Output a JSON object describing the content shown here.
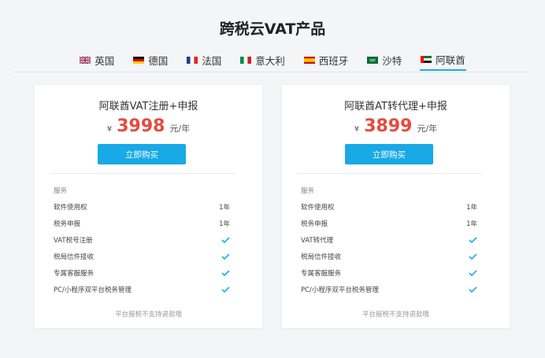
{
  "page": {
    "title": "跨税云VAT产品"
  },
  "tabs": [
    {
      "label": "英国",
      "flag": "uk-flag-icon",
      "active": false
    },
    {
      "label": "德国",
      "flag": "germany-flag-icon",
      "active": false
    },
    {
      "label": "法国",
      "flag": "france-flag-icon",
      "active": false
    },
    {
      "label": "意大利",
      "flag": "italy-flag-icon",
      "active": false
    },
    {
      "label": "西班牙",
      "flag": "spain-flag-icon",
      "active": false
    },
    {
      "label": "沙特",
      "flag": "saudi-flag-icon",
      "active": false
    },
    {
      "label": "阿联酋",
      "flag": "uae-flag-icon",
      "active": true
    }
  ],
  "cards": [
    {
      "title": "阿联酋VAT注册+申报",
      "currency": "¥",
      "price": "3998",
      "unit": "元/年",
      "button": "立即购买",
      "service_header": "服务",
      "features": [
        {
          "label": "软件使用权",
          "value": "1年"
        },
        {
          "label": "税务申报",
          "value": "1年"
        },
        {
          "label": "VAT税号注册",
          "value": "check"
        },
        {
          "label": "税局信件接收",
          "value": "check"
        },
        {
          "label": "专属客服服务",
          "value": "check"
        },
        {
          "label": "PC/小程序双平台税务管理",
          "value": "check"
        }
      ],
      "note": "平台报税不支持退款哦"
    },
    {
      "title": "阿联酋AT转代理+申报",
      "currency": "¥",
      "price": "3899",
      "unit": "元/年",
      "button": "立即购买",
      "service_header": "服务",
      "features": [
        {
          "label": "软件使用权",
          "value": "1年"
        },
        {
          "label": "税务申报",
          "value": "1年"
        },
        {
          "label": "VAT转代理",
          "value": "check"
        },
        {
          "label": "税局信件接收",
          "value": "check"
        },
        {
          "label": "专属客服服务",
          "value": "check"
        },
        {
          "label": "PC/小程序双平台税务管理",
          "value": "check"
        }
      ],
      "note": "平台报税不支持退款哦"
    }
  ],
  "colors": {
    "accent": "#18a9e6",
    "price": "#e64a3f",
    "check": "#1aaee8"
  }
}
